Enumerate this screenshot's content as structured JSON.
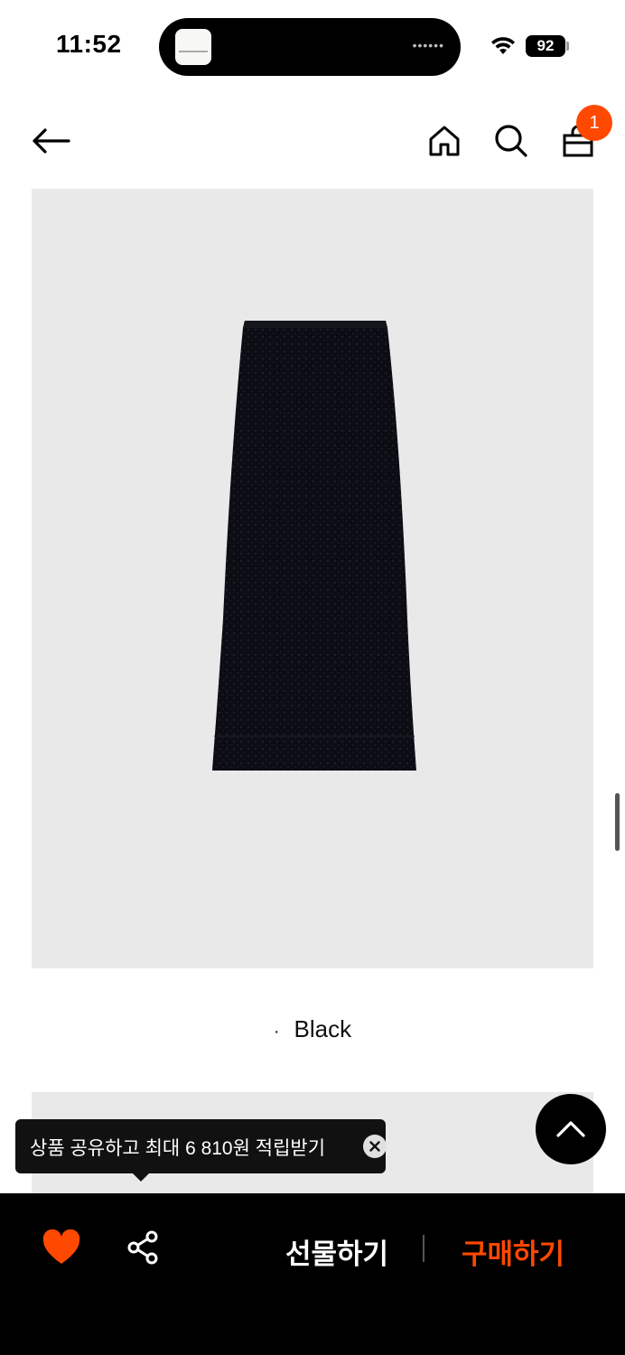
{
  "status_bar": {
    "time": "11:52",
    "battery": "92"
  },
  "nav": {
    "cart_count": "1"
  },
  "product": {
    "color_option": "Black"
  },
  "tooltip": {
    "text": "상품 공유하고 최대 6 810원 적립받기"
  },
  "bottom_bar": {
    "gift_label": "선물하기",
    "buy_label": "구매하기"
  },
  "colors": {
    "accent": "#ff4800",
    "image_bg": "#e9e9ea",
    "bar_bg": "#000000"
  },
  "icons": [
    "back-arrow-icon",
    "home-icon",
    "search-icon",
    "shopping-bag-icon",
    "heart-icon",
    "share-icon",
    "chevron-up-icon",
    "close-icon",
    "wifi-icon"
  ]
}
